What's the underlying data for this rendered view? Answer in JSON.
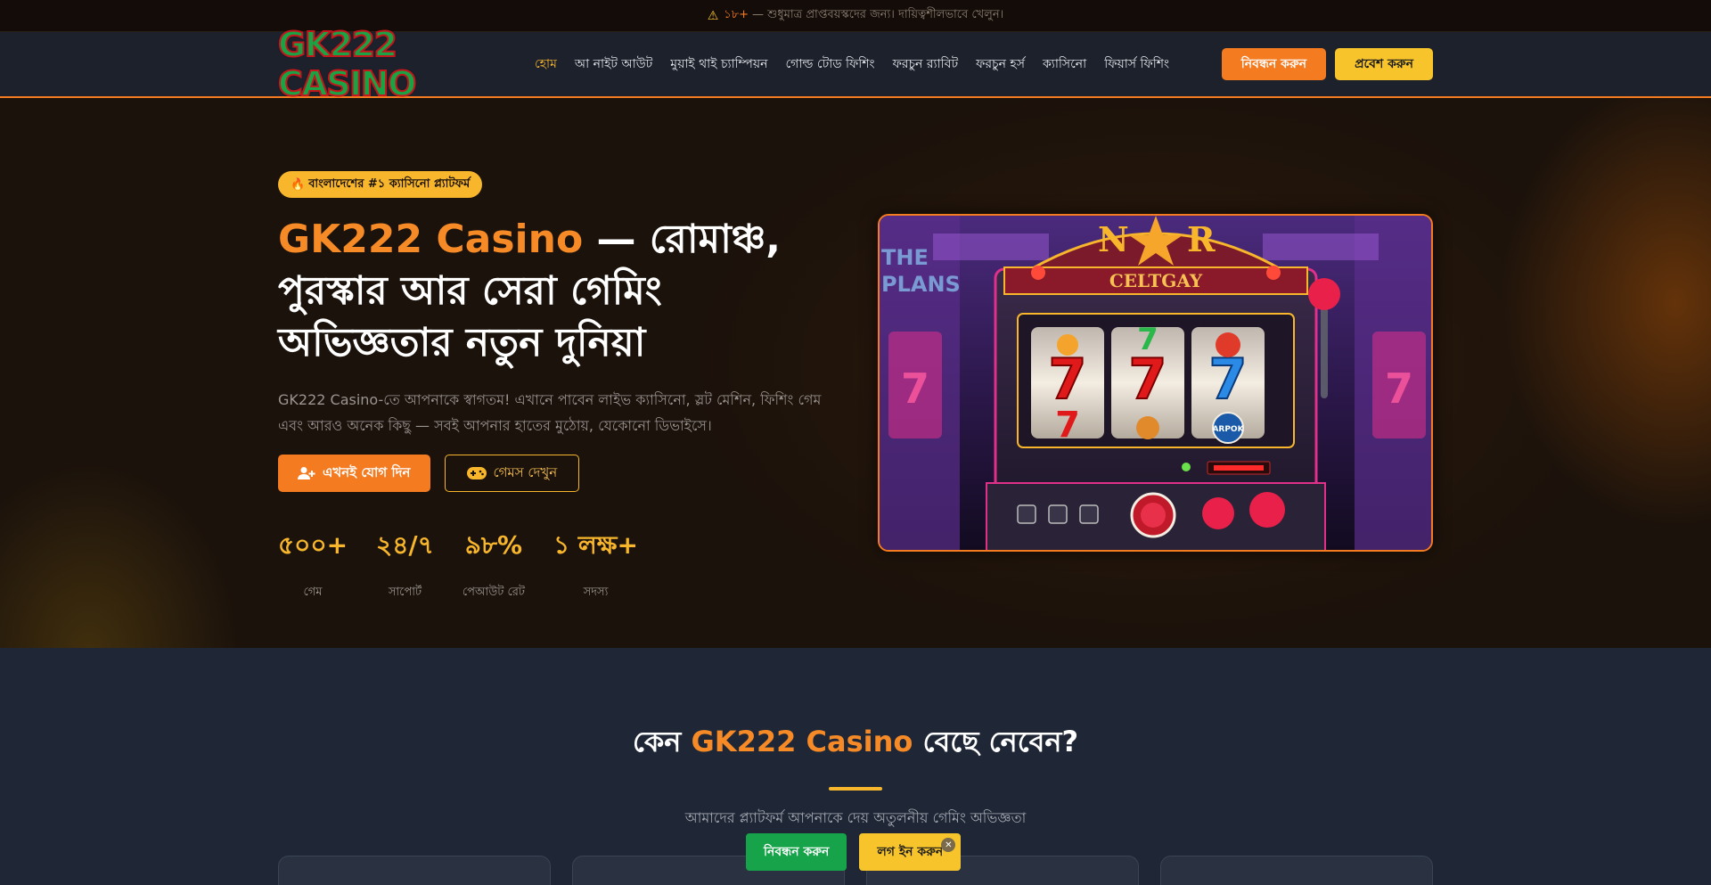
{
  "notice": {
    "icon": "warning-icon",
    "age": "১৮+",
    "text": "— শুধুমাত্র প্রাপ্তবয়স্কদের জন্য। দায়িত্বশীলভাবে খেলুন।"
  },
  "header": {
    "logo": "GK222 CASINO",
    "nav": [
      {
        "label": "হোম",
        "active": true
      },
      {
        "label": "আ নাইট আউট"
      },
      {
        "label": "মুয়াই থাই চ্যাম্পিয়ন"
      },
      {
        "label": "গোল্ড টোড ফিশিং"
      },
      {
        "label": "ফরচুন র‍্যাবিট"
      },
      {
        "label": "ফরচুন হর্স"
      },
      {
        "label": "ক্যাসিনো"
      },
      {
        "label": "ফিয়ার্স ফিশিং"
      }
    ],
    "register_label": "নিবন্ধন করুন",
    "login_label": "প্রবেশ করুন"
  },
  "hero": {
    "badge": "বাংলাদেশের #১ ক্যাসিনো প্ল্যাটফর্ম",
    "headline_brand": "GK222 Casino",
    "headline_line1_rest": " — রোমাঞ্চ,",
    "headline_line2": "পুরস্কার আর সেরা গেমিং",
    "headline_line3": "অভিজ্ঞতার নতুন দুনিয়া",
    "subtitle": "GK222 Casino-তে আপনাকে স্বাগতম! এখানে পাবেন লাইভ ক্যাসিনো, স্লট মেশিন, ফিশিং গেম এবং আরও অনেক কিছু — সবই আপনার হাতের মুঠোয়, যেকোনো ডিভাইসে।",
    "cta_join": "এখনই যোগ দিন",
    "cta_games": "গেমস দেখুন",
    "stats": [
      {
        "num": "৫০০+",
        "label": "গেম"
      },
      {
        "num": "২৪/৭",
        "label": "সাপোর্ট"
      },
      {
        "num": "৯৮%",
        "label": "পেআউট রেট"
      },
      {
        "num": "১ লক্ষ+",
        "label": "সদস্য"
      }
    ],
    "image": {
      "sign_top": "N★R",
      "sign_bottom": "CELTGAY",
      "button_text": "ARPOK"
    }
  },
  "why": {
    "title_pre": "কেন ",
    "title_brand": "GK222 Casino",
    "title_post": " বেছে নেবেন?",
    "subtitle": "আমাদের প্ল্যাটফর্ম আপনাকে দেয় অতুলনীয় গেমিং অভিজ্ঞতা"
  },
  "floating": {
    "register": "নিবন্ধন করুন",
    "login": "লগ ইন করুন",
    "close": "✕"
  },
  "colors": {
    "accent": "#f47b20",
    "gold": "#f7b62c",
    "green": "#16a34a"
  }
}
